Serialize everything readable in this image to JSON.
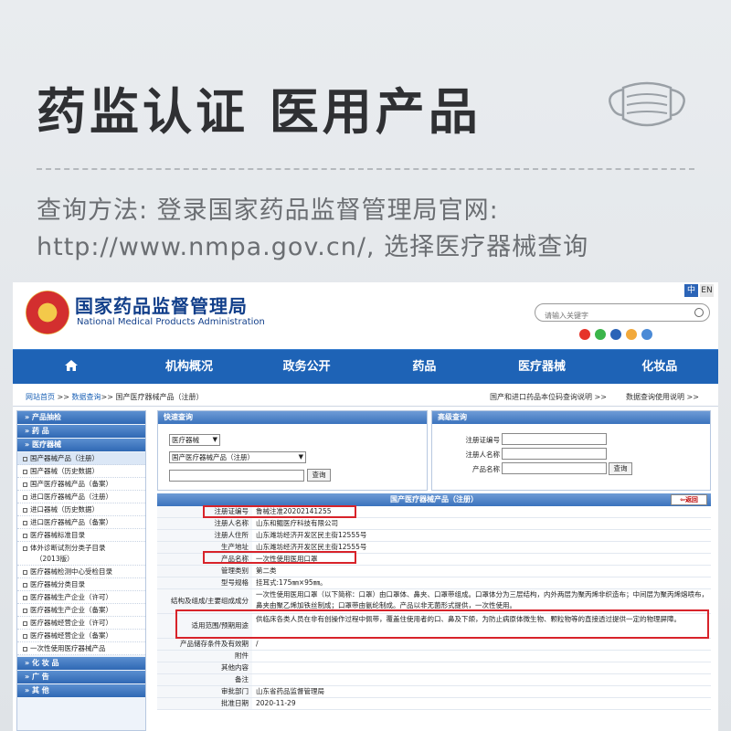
{
  "banner": {
    "title": "药监认证  医用产品",
    "hint_line1": "查询方法: 登录国家药品监督管理局官网:",
    "hint_line2": "http://www.nmpa.gov.cn/, 选择医疗器械查询"
  },
  "site": {
    "name_cn": "国家药品监督管理局",
    "name_en": "National Medical Products Administration",
    "lang_zh": "中",
    "lang_en": "EN",
    "search_placeholder": "请输入关键字"
  },
  "nav": {
    "items": [
      "机构概况",
      "政务公开",
      "药品",
      "医疗器械",
      "化妆品"
    ]
  },
  "breadcrumb": {
    "home": "网站首页",
    "sep1": " >> ",
    "query": "数据查询",
    "rest": ">> 国产医疗器械产品（注册）",
    "right1": "国产和进口药品本位码查询说明 >>",
    "right2": "数据查询使用说明 >>"
  },
  "sidebar": {
    "categories": {
      "cat1": "» 产品抽检",
      "cat2": "» 药      品",
      "cat3": "» 医疗器械",
      "cat4": "» 化 妆 品",
      "cat5": "» 广      告",
      "cat6": "» 其      他"
    },
    "items": [
      "国产器械产品（注册）",
      "国产器械（历史数据）",
      "国产医疗器械产品（备案）",
      "进口医疗器械产品（注册）",
      "进口器械（历史数据）",
      "进口医疗器械产品（备案）",
      "医疗器械标准目录",
      "体外诊断试剂分类子目录",
      "（2013版）",
      "医疗器械检测中心受检目录",
      "医疗器械分类目录",
      "医疗器械生产企业（许可）",
      "医疗器械生产企业（备案）",
      "医疗器械经营企业（许可）",
      "医疗器械经营企业（备案）",
      "一次性使用医疗器械产品"
    ]
  },
  "quick_search": {
    "title": "快速查询",
    "select1": "医疗器械",
    "select2": "国产医疗器械产品（注册）",
    "button": "查询"
  },
  "advanced_search": {
    "title": "高级查询",
    "label_reg_no": "注册证编号",
    "label_registrant": "注册人名称",
    "label_product": "产品名称",
    "button": "查询"
  },
  "detail": {
    "title": "国产医疗器械产品（注册）",
    "back": "返回",
    "rows": [
      {
        "k": "注册证编号",
        "v": "鲁械注准20202141255"
      },
      {
        "k": "注册人名称",
        "v": "山东和鲲医疗科技有限公司"
      },
      {
        "k": "注册人住所",
        "v": "山东潍坊经济开发区民主街12555号"
      },
      {
        "k": "生产地址",
        "v": "山东潍坊经济开发区民主街12555号"
      },
      {
        "k": "产品名称",
        "v": "一次性使用医用口罩"
      },
      {
        "k": "管理类别",
        "v": "第二类"
      },
      {
        "k": "型号规格",
        "v": "挂耳式:175㎜×95㎜。"
      },
      {
        "k": "结构及组成/主要组成成分",
        "v": "一次性使用医用口罩（以下简称：口罩）由口罩体、鼻夹、口罩带组成。口罩体分为三层结构，内外两层为聚丙烯非织造布；中间层为聚丙烯熔喷布，鼻夹由聚乙烯加铁丝制成；口罩带由氨纶制成。产品以非无菌形式提供，一次性使用。"
      },
      {
        "k": "适用范围/预期用途",
        "v": "供临床各类人员在非有创操作过程中佩带，覆盖住使用者的口、鼻及下颌，为防止病原体微生物、颗粒物等的直接透过提供一定的物理屏障。"
      },
      {
        "k": "产品储存条件及有效期",
        "v": "/"
      },
      {
        "k": "附件",
        "v": ""
      },
      {
        "k": "其他内容",
        "v": ""
      },
      {
        "k": "备注",
        "v": ""
      },
      {
        "k": "审批部门",
        "v": "山东省药品监督管理局"
      },
      {
        "k": "批准日期",
        "v": "2020-11-29"
      }
    ]
  },
  "colors": {
    "nav_blue": "#1e63b6",
    "highlight_red": "#d8232a"
  }
}
